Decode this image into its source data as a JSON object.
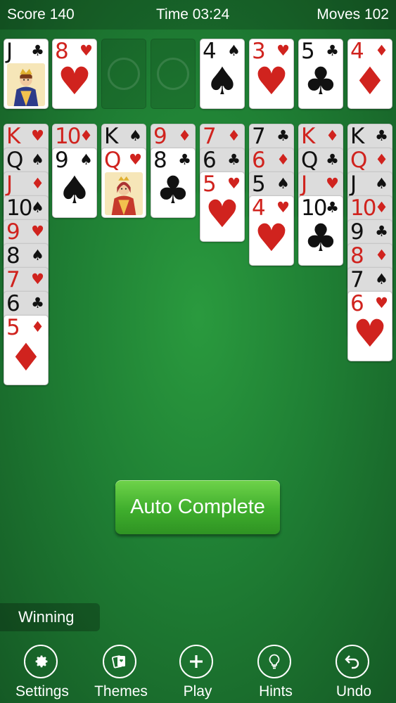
{
  "topbar": {
    "score": "Score 140",
    "time": "Time 03:24",
    "moves": "Moves 102"
  },
  "colors": {
    "red_suit": "#d0231e",
    "black_suit": "#111111",
    "button_green": "#3fae2d",
    "felt_green": "#1f7f34"
  },
  "free_cells": [
    {
      "rank": "J",
      "suit": "♣",
      "color": "black",
      "face_card": true
    },
    {
      "rank": "8",
      "suit": "♥",
      "color": "red"
    },
    null,
    null
  ],
  "foundations": [
    {
      "rank": "4",
      "suit": "♠",
      "color": "black"
    },
    {
      "rank": "3",
      "suit": "♥",
      "color": "red"
    },
    {
      "rank": "5",
      "suit": "♣",
      "color": "black"
    },
    {
      "rank": "4",
      "suit": "♦",
      "color": "red"
    }
  ],
  "tableau": [
    [
      {
        "rank": "K",
        "suit": "♥",
        "color": "red"
      },
      {
        "rank": "Q",
        "suit": "♠",
        "color": "black"
      },
      {
        "rank": "J",
        "suit": "♦",
        "color": "red"
      },
      {
        "rank": "10",
        "suit": "♠",
        "color": "black"
      },
      {
        "rank": "9",
        "suit": "♥",
        "color": "red"
      },
      {
        "rank": "8",
        "suit": "♠",
        "color": "black"
      },
      {
        "rank": "7",
        "suit": "♥",
        "color": "red"
      },
      {
        "rank": "6",
        "suit": "♣",
        "color": "black"
      },
      {
        "rank": "5",
        "suit": "♦",
        "color": "red"
      }
    ],
    [
      {
        "rank": "10",
        "suit": "♦",
        "color": "red"
      },
      {
        "rank": "9",
        "suit": "♠",
        "color": "black"
      }
    ],
    [
      {
        "rank": "K",
        "suit": "♠",
        "color": "black"
      },
      {
        "rank": "Q",
        "suit": "♥",
        "color": "red",
        "face_card": true
      }
    ],
    [
      {
        "rank": "9",
        "suit": "♦",
        "color": "red"
      },
      {
        "rank": "8",
        "suit": "♣",
        "color": "black"
      }
    ],
    [
      {
        "rank": "7",
        "suit": "♦",
        "color": "red"
      },
      {
        "rank": "6",
        "suit": "♣",
        "color": "black"
      },
      {
        "rank": "5",
        "suit": "♥",
        "color": "red"
      }
    ],
    [
      {
        "rank": "7",
        "suit": "♣",
        "color": "black"
      },
      {
        "rank": "6",
        "suit": "♦",
        "color": "red"
      },
      {
        "rank": "5",
        "suit": "♠",
        "color": "black"
      },
      {
        "rank": "4",
        "suit": "♥",
        "color": "red"
      }
    ],
    [
      {
        "rank": "K",
        "suit": "♦",
        "color": "red"
      },
      {
        "rank": "Q",
        "suit": "♣",
        "color": "black"
      },
      {
        "rank": "J",
        "suit": "♥",
        "color": "red"
      },
      {
        "rank": "10",
        "suit": "♣",
        "color": "black"
      }
    ],
    [
      {
        "rank": "K",
        "suit": "♣",
        "color": "black"
      },
      {
        "rank": "Q",
        "suit": "♦",
        "color": "red"
      },
      {
        "rank": "J",
        "suit": "♠",
        "color": "black"
      },
      {
        "rank": "10",
        "suit": "♦",
        "color": "red"
      },
      {
        "rank": "9",
        "suit": "♣",
        "color": "black"
      },
      {
        "rank": "8",
        "suit": "♦",
        "color": "red"
      },
      {
        "rank": "7",
        "suit": "♠",
        "color": "black"
      },
      {
        "rank": "6",
        "suit": "♥",
        "color": "red"
      }
    ]
  ],
  "auto_complete_label": "Auto Complete",
  "winning_label": "Winning",
  "nav": [
    {
      "label": "Settings",
      "icon": "gear-icon"
    },
    {
      "label": "Themes",
      "icon": "themes-cards-icon"
    },
    {
      "label": "Play",
      "icon": "plus-icon"
    },
    {
      "label": "Hints",
      "icon": "lightbulb-icon"
    },
    {
      "label": "Undo",
      "icon": "undo-arrow-icon"
    }
  ]
}
